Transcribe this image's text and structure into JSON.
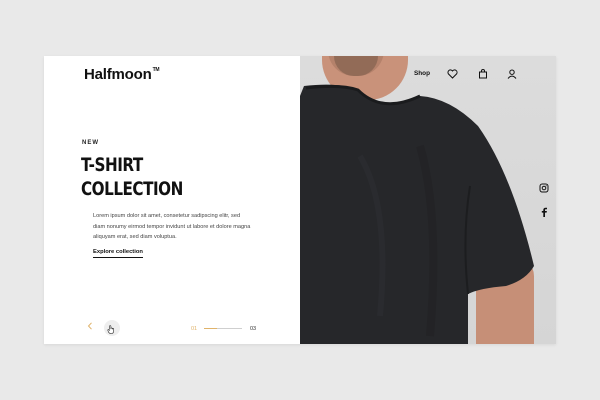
{
  "brand": {
    "name": "Halfmoon",
    "mark": "TM"
  },
  "hero": {
    "eyebrow": "NEW",
    "title_line1": "T-SHIRT",
    "title_line2": "COLLECTION",
    "description": "Lorem ipsum dolor sit amet, consetetur sadipscing elitr, sed diam nonumy eirmod tempor invidunt ut labore et dolore magna aliquyam erat, sed diam voluptua.",
    "cta_label": "Explore collection"
  },
  "slider": {
    "current": "01",
    "total": "03",
    "progress": 0.33
  },
  "nav": {
    "shop_label": "Shop",
    "icons": [
      "heart-icon",
      "bag-icon",
      "user-icon"
    ]
  },
  "social": {
    "icons": [
      "instagram-icon",
      "facebook-icon"
    ]
  },
  "colors": {
    "accent": "#e0b36a",
    "shirt": "#26272a",
    "background": "#e9e9e9"
  }
}
